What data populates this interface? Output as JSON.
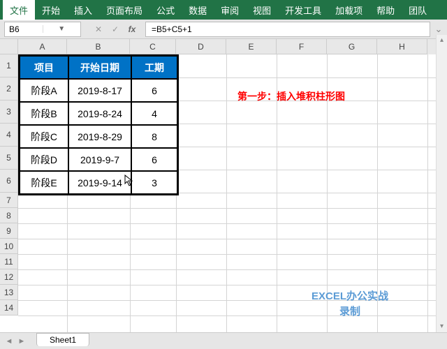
{
  "ribbon": {
    "tabs": [
      "文件",
      "开始",
      "插入",
      "页面布局",
      "公式",
      "数据",
      "审阅",
      "视图",
      "开发工具",
      "加载项",
      "帮助",
      "团队"
    ],
    "active": 0
  },
  "nameBox": "B6",
  "formula": "=B5+C5+1",
  "cols": [
    "A",
    "B",
    "C",
    "D",
    "E",
    "F",
    "G",
    "H"
  ],
  "rows": [
    "1",
    "2",
    "3",
    "4",
    "5",
    "6",
    "7",
    "8",
    "9",
    "10",
    "11",
    "12",
    "13",
    "14"
  ],
  "table": {
    "headers": [
      "项目",
      "开始日期",
      "工期"
    ],
    "rows": [
      [
        "阶段A",
        "2019-8-17",
        "6"
      ],
      [
        "阶段B",
        "2019-8-24",
        "4"
      ],
      [
        "阶段C",
        "2019-8-29",
        "8"
      ],
      [
        "阶段D",
        "2019-9-7",
        "6"
      ],
      [
        "阶段E",
        "2019-9-14",
        "3"
      ]
    ]
  },
  "annotation": "第一步：插入堆积柱形图",
  "watermark": {
    "line1": "EXCEL办公实战",
    "line2": "录制"
  },
  "sheetTab": "Sheet1"
}
